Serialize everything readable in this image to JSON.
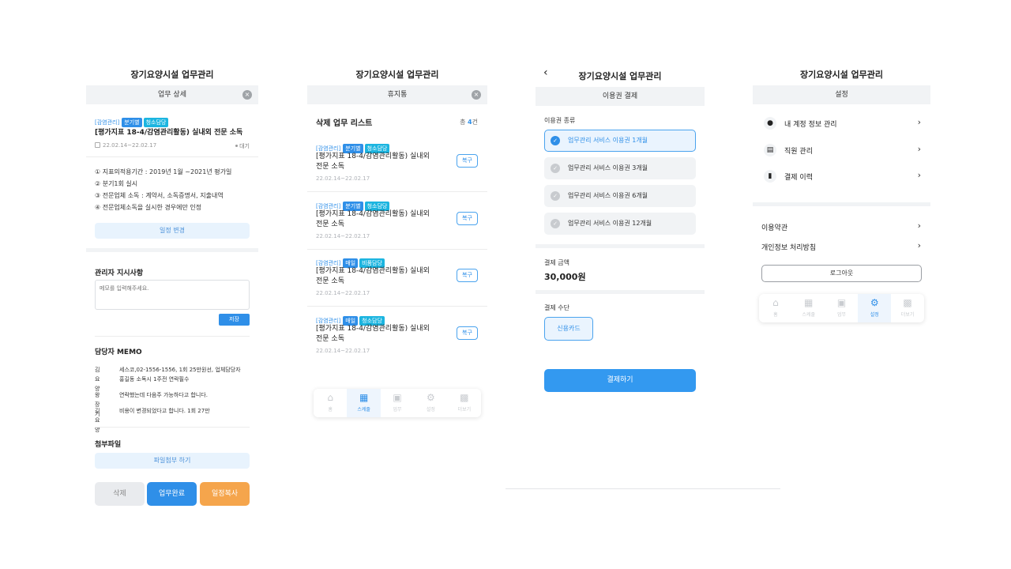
{
  "app_title": "장기요양시설 업무관리",
  "screen1": {
    "subbar": "업무 상세",
    "close_icon": "×",
    "tags": [
      "[감염관리]",
      "분기별",
      "청소담당"
    ],
    "title": "[평가지표 18-4/감염관리활동) 실내외 전문 소독",
    "date": "22.02.14~22.02.17",
    "status": "대기",
    "details": [
      "① 지표의적용기간 : 2019년 1월 ~2021년 평가일",
      "② 분기1회 실시",
      "③ 전문업체 소독 : 계약서, 소독증명서, 지출내역",
      "④ 전문업체소독을 실시한 경우에만 인정"
    ],
    "schedule_change": "일정 변경",
    "admin_title": "관리자 지시사항",
    "memo_placeholder": "메모를 입력해주세요.",
    "save_label": "저장",
    "memo_title": "담당자 MEMO",
    "memos": [
      {
        "name": "김요양",
        "text1": "세스코,02-1556-1556, 1회 25만원선, 업체담당자",
        "text2": "홍길동 소독시 1주전 연락필수"
      },
      {
        "name": "왕장기",
        "text1": "연락했는데 다음주 가능하다고 합니다.",
        "text2": ""
      },
      {
        "name": "김요양",
        "text1": "비용이 변경되었다고 합니다. 1회 27만",
        "text2": ""
      }
    ],
    "attach_title": "첨부파일",
    "attach_btn": "파일첨부 하기",
    "delete_btn": "삭제",
    "complete_btn": "업무완료",
    "copy_btn": "일정복사"
  },
  "screen2": {
    "subbar": "휴지통",
    "close_icon": "×",
    "list_title": "삭제 업무 리스트",
    "count_prefix": "총 ",
    "count": "4",
    "count_suffix": "건",
    "items": [
      {
        "tags": [
          "[감염관리]",
          "분기별",
          "청소담당"
        ],
        "line1": "[평가지표 18-4/감염관리활동) 실내외",
        "line2": "전문 소독",
        "date": "22.02.14~22.02.17",
        "restore": "복구"
      },
      {
        "tags": [
          "[감염관리]",
          "분기별",
          "청소담당"
        ],
        "line1": "[평가지표 18-4/감염관리활동) 실내외",
        "line2": "전문 소독",
        "date": "22.02.14~22.02.17",
        "restore": "복구"
      },
      {
        "tags": [
          "[감염관리]",
          "매일",
          "비품담당"
        ],
        "line1": "[평가지표 18-4/감염관리활동) 실내외",
        "line2": "전문 소독",
        "date": "22.02.14~22.02.17",
        "restore": "복구"
      },
      {
        "tags": [
          "[감염관리]",
          "매일",
          "청소담당"
        ],
        "line1": "[평가지표 18-4/감염관리활동) 실내외",
        "line2": "전문 소독",
        "date": "22.02.14~22.02.17",
        "restore": "복구"
      }
    ],
    "tabs": [
      "홈",
      "스케줄",
      "업무",
      "설정",
      "더보기"
    ]
  },
  "screen3": {
    "back_icon": "‹",
    "subbar": "이용권 결제",
    "ticket_title": "이용권 종류",
    "options": [
      "업무관리 서비스 이용권 1개월",
      "업무관리 서비스 이용권 3개월",
      "업무관리 서비스 이용권 6개월",
      "업무관리 서비스 이용권 12개월"
    ],
    "amount_label": "결제 금액",
    "amount": "30,000원",
    "method_label": "결제 수단",
    "method": "신용카드",
    "pay_btn": "결제하기"
  },
  "screen4": {
    "subbar": "설정",
    "menu": [
      {
        "label": "내 계정 정보 관리",
        "icon": "user-icon"
      },
      {
        "label": "직원 관리",
        "icon": "id-card-icon"
      },
      {
        "label": "결제 이력",
        "icon": "wallet-icon"
      }
    ],
    "links": [
      "이용약관",
      "개인정보 처리방침"
    ],
    "logout": "로그아웃",
    "tabs": [
      "홈",
      "스케줄",
      "업무",
      "설정",
      "더보기"
    ]
  },
  "colors": {
    "primary": "#2f8fe8",
    "orange": "#f5a54c",
    "gray_btn": "#e9ebee",
    "light_bg": "#f1f3f5"
  }
}
